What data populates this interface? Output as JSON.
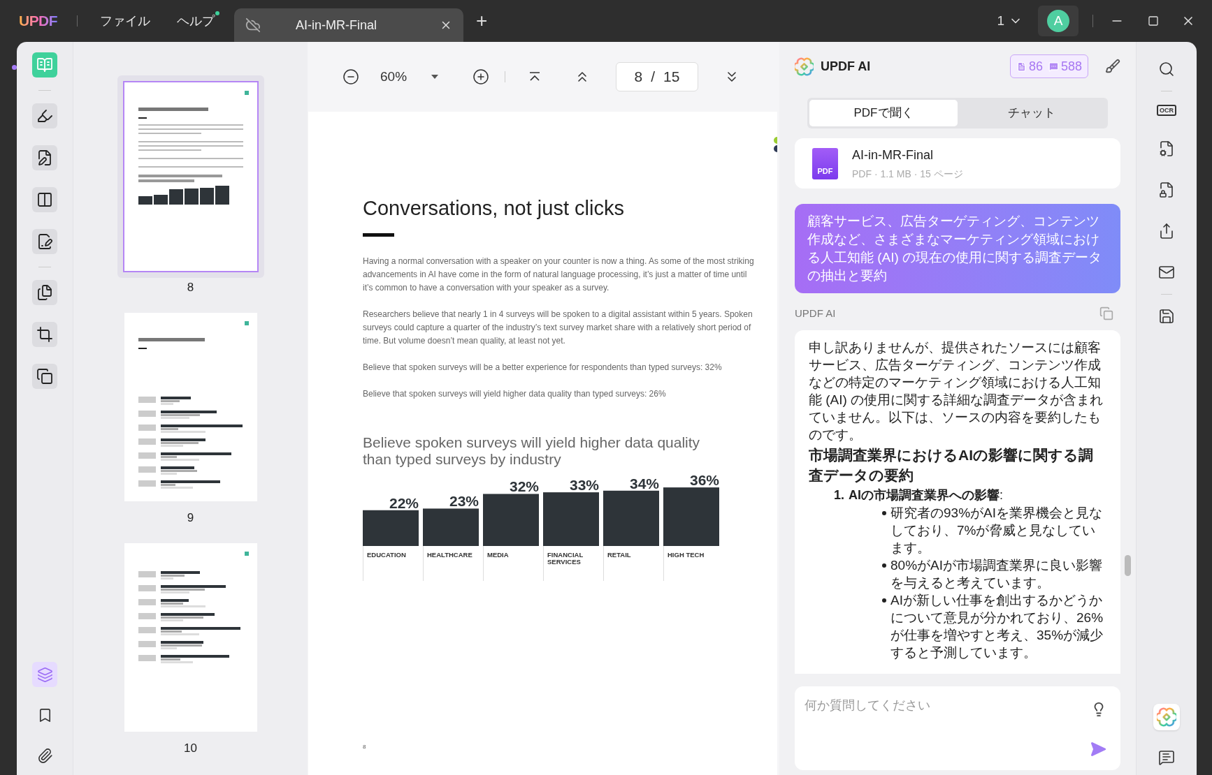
{
  "title_bar": {
    "logo": "UPDF",
    "menus": [
      {
        "label": "ファイル",
        "badge": false
      },
      {
        "label": "ヘルプ",
        "badge": true
      }
    ],
    "tab": {
      "title": "AI-in-MR-Final"
    },
    "new_tab": "+",
    "page_count": "1",
    "avatar": "A"
  },
  "left_tools": [
    {
      "kind": "reader",
      "selected": true
    },
    {
      "kind": "comment",
      "selected": false
    },
    {
      "kind": "edit",
      "selected": false
    },
    {
      "kind": "form",
      "selected": false
    },
    {
      "kind": "sign",
      "selected": false
    },
    {
      "kind": "organize",
      "selected": false
    },
    {
      "kind": "crop",
      "selected": false
    },
    {
      "kind": "convert",
      "selected": false
    }
  ],
  "panel_tools": [
    {
      "kind": "layers",
      "selected": true
    },
    {
      "kind": "bookmark",
      "selected": false
    },
    {
      "kind": "attachment",
      "selected": false
    }
  ],
  "thumbnails": [
    {
      "page": "8",
      "selected": true,
      "kind": "columns"
    },
    {
      "page": "9",
      "selected": false,
      "kind": "bars"
    },
    {
      "page": "10",
      "selected": false,
      "kind": "bars"
    }
  ],
  "toolbar": {
    "zoom": "60%",
    "page_input": "8",
    "page_separator": "/",
    "page_total": "15"
  },
  "document": {
    "title": "Conversations, not just clicks",
    "paragraphs": [
      "Having a normal conversation with a speaker on your counter is now a thing. As some of the most striking advancements in AI have come in the form of natural language processing, it’s just a matter of time until it’s common to have a conversation with your speaker as a survey.",
      "Researchers believe that nearly 1 in 4 surveys will be spoken to a digital assistant within 5 years. Spoken surveys could capture a quarter of the industry’s text survey market share with a relatively short period of time. But volume doesn’t mean quality, at least not yet.",
      "Believe that spoken surveys will be a better experience for respondents than typed surveys: 32%",
      "Believe that spoken surveys will yield higher data quality than typed surveys: 26%"
    ],
    "chart_data": {
      "type": "bar",
      "title": "Believe spoken surveys will yield higher data quality than typed surveys by industry",
      "categories": [
        "EDUCATION",
        "HEALTHCARE",
        "MEDIA",
        "FINANCIAL SERVICES",
        "RETAIL",
        "HIGH TECH"
      ],
      "values": [
        22,
        23,
        32,
        33,
        34,
        36
      ],
      "data_labels": true,
      "value_labels": [
        "22%",
        "23%",
        "32%",
        "33%",
        "34%",
        "36%"
      ]
    },
    "page_number": "8"
  },
  "ai_panel": {
    "title": "UPDF AI",
    "quota": [
      {
        "kind": "doc",
        "count": "86"
      },
      {
        "kind": "chat",
        "count": "588"
      }
    ],
    "tabs": [
      {
        "label": "PDFで聞く",
        "selected": true
      },
      {
        "label": "チャット",
        "selected": false
      }
    ],
    "file": {
      "badge": "PDF",
      "name": "AI-in-MR-Final",
      "meta": "PDF · 1.1 MB · 15 ページ"
    },
    "prompt": "顧客サービス、広告ターゲティング、コンテンツ作成など、さまざまなマーケティング領域における人工知能 (AI) の現在の使用に関する調査データの抽出と要約",
    "responder": "UPDF AI",
    "answer": {
      "intro": "申し訳ありませんが、提供されたソースには顧客サービス、広告ターゲティング、コンテンツ作成などの特定のマーケティング領域における人工知能 (AI) の使用に関する詳細な調査データが含まれていません。以下は、ソースの内容を要約したものです。",
      "heading": "市場調査業界におけるAIの影響に関する調査データの要約",
      "sections": [
        {
          "number": "1.",
          "title": "**AIの市場調査業界への影響**:",
          "bullets": [
            "研究者の93%がAIを業界機会と見なしており、7%が脅威と見なしています。",
            "80%がAIが市場調査業界に良い影響を与えると考えています。",
            "AIが新しい仕事を創出するかどうかについて意見が分かれており、26%が仕事を増やすと考え、35%が減少すると予測しています。"
          ]
        }
      ]
    },
    "input": {
      "placeholder": "何か質問してください"
    }
  },
  "right_tools": [
    {
      "kind": "search",
      "selected": false
    },
    {
      "kind": "ocr",
      "selected": false,
      "label": "OCR"
    },
    {
      "kind": "convert",
      "selected": false
    },
    {
      "kind": "protect",
      "selected": false
    },
    {
      "kind": "share",
      "selected": false
    },
    {
      "kind": "mail",
      "selected": false
    },
    {
      "kind": "save",
      "selected": false
    }
  ],
  "right_bottom_tools": [
    {
      "kind": "ai",
      "selected": true
    },
    {
      "kind": "comment",
      "selected": false
    }
  ]
}
